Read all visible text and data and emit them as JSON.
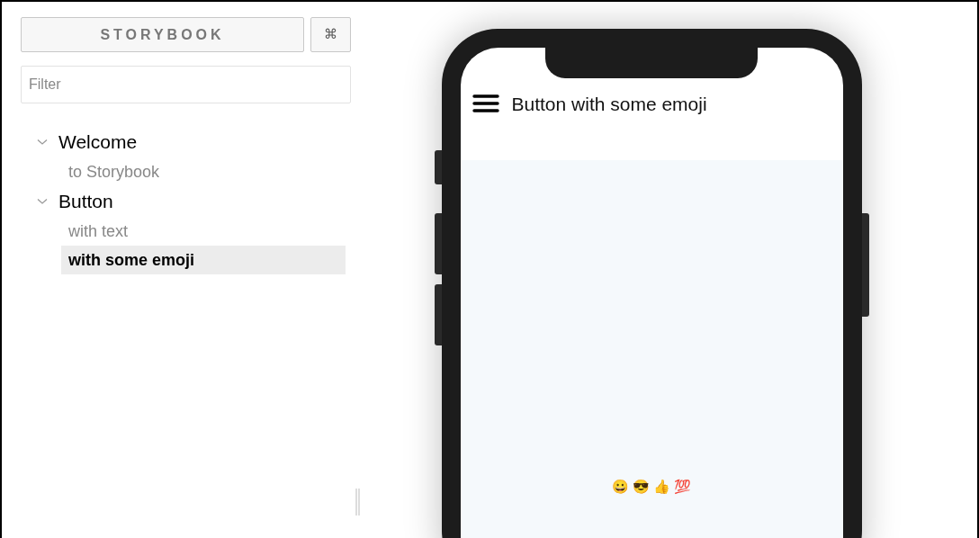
{
  "sidebar": {
    "brand_button": "STORYBOOK",
    "shortcut_button": "⌘",
    "filter": {
      "placeholder": "Filter"
    },
    "tree": [
      {
        "label": "Welcome",
        "expanded": true,
        "children": [
          {
            "label": "to Storybook",
            "selected": false
          }
        ]
      },
      {
        "label": "Button",
        "expanded": true,
        "children": [
          {
            "label": "with text",
            "selected": false
          },
          {
            "label": "with some emoji",
            "selected": true
          }
        ]
      }
    ]
  },
  "preview": {
    "header_title": "Button with some emoji",
    "button_label": "😀 😎 👍 💯"
  }
}
